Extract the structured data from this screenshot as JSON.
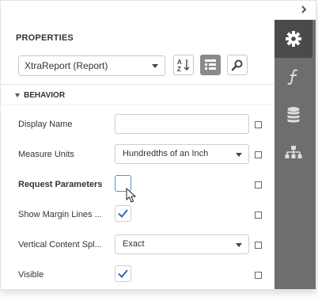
{
  "panel": {
    "title": "PROPERTIES",
    "report_selector": {
      "value": "XtraReport (Report)"
    },
    "group": {
      "label": "BEHAVIOR"
    }
  },
  "rows": [
    {
      "label": "Display Name",
      "type": "text",
      "value": "",
      "bold": false
    },
    {
      "label": "Measure Units",
      "type": "select",
      "value": "Hundredths of an Inch",
      "bold": false
    },
    {
      "label": "Request Parameters",
      "type": "checkbox",
      "checked": false,
      "bold": true
    },
    {
      "label": "Show Margin Lines ...",
      "type": "checkbox",
      "checked": true,
      "bold": false
    },
    {
      "label": "Vertical Content Spl...",
      "type": "select",
      "value": "Exact",
      "bold": false
    },
    {
      "label": "Visible",
      "type": "checkbox",
      "checked": true,
      "bold": false
    }
  ],
  "toolbar": {
    "sort_icon": "sort-alphabetical-icon",
    "categorized_icon": "categorized-view-icon",
    "search_icon": "search-icon"
  },
  "sidebar": {
    "tabs": [
      {
        "icon": "gear-icon",
        "active": true
      },
      {
        "icon": "function-icon",
        "active": false
      },
      {
        "icon": "database-icon",
        "active": false
      },
      {
        "icon": "hierarchy-icon",
        "active": false
      }
    ]
  },
  "colors": {
    "sidebar_bg": "#6e6e6e",
    "sidebar_active": "#4a4a4a",
    "check_color": "#2f66c4",
    "focus_border": "#5b8fd6"
  }
}
